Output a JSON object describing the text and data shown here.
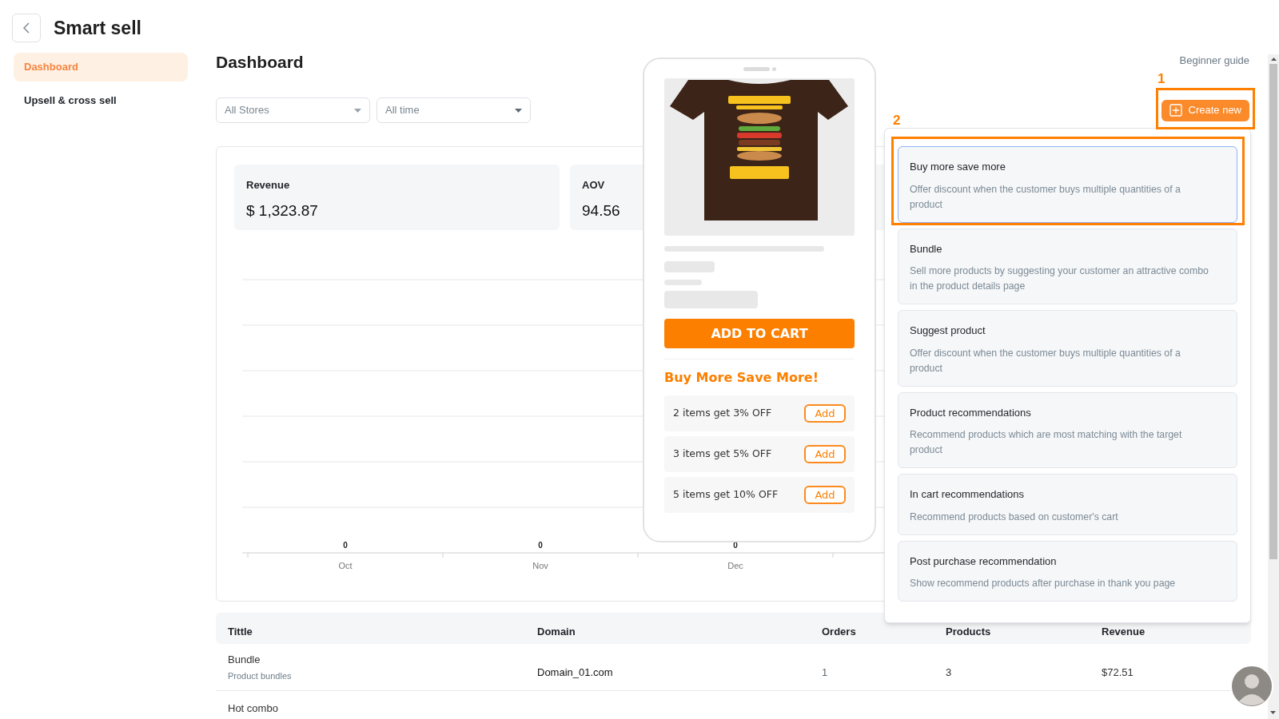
{
  "app": {
    "title": "Smart sell"
  },
  "sidebar": {
    "items": [
      {
        "label": "Dashboard",
        "selected": true
      },
      {
        "label": "Upsell & cross sell",
        "selected": false
      }
    ]
  },
  "page": {
    "title": "Dashboard",
    "guide_link": "Beginner guide",
    "create_button": "Create new"
  },
  "filters": [
    "All Stores",
    "All time"
  ],
  "stats": [
    {
      "label": "Revenue",
      "value": "$ 1,323.87"
    },
    {
      "label": "AOV",
      "value": "94.56"
    }
  ],
  "revenue_chart": {
    "columns": [
      {
        "month": "Oct",
        "value_label": "0"
      },
      {
        "month": "Nov",
        "value_label": "0"
      },
      {
        "month": "Dec",
        "value_label": "0"
      }
    ]
  },
  "table": {
    "columns": [
      "Tittle",
      "Domain",
      "Orders",
      "Products",
      "Revenue"
    ],
    "rows": [
      {
        "title": "Bundle",
        "subtitle": "Product bundles",
        "domain": "Domain_01.com",
        "orders": "1",
        "products": "3",
        "revenue": "$72.51"
      },
      {
        "title": "Hot combo"
      }
    ]
  },
  "preview": {
    "add_to_cart": "ADD TO CART",
    "offer_title": "Buy More Save More!",
    "tiers": [
      {
        "label": "2 items get 3% OFF",
        "button": "Add"
      },
      {
        "label": "3 items get 5% OFF",
        "button": "Add"
      },
      {
        "label": "5 items get 10% OFF",
        "button": "Add"
      }
    ]
  },
  "create_menu": {
    "options": [
      {
        "title": "Buy more save more",
        "description": "Offer discount when the customer buys multiple quantities of a product",
        "selected": true
      },
      {
        "title": "Bundle",
        "description": "Sell more products by suggesting your customer an attractive combo in the product details page",
        "selected": false
      },
      {
        "title": "Suggest product",
        "description": "Offer discount when the customer buys multiple quantities of a product",
        "selected": false
      },
      {
        "title": "Product recommendations",
        "description": "Recommend products which are most matching with the target product",
        "selected": false
      },
      {
        "title": "In cart recommendations",
        "description": "Recommend products based on customer's cart",
        "selected": false
      },
      {
        "title": "Post purchase recommendation",
        "description": "Show recommend products after purchase in thank you page",
        "selected": false
      }
    ]
  },
  "annotations": [
    {
      "label": "1"
    },
    {
      "label": "2"
    }
  ]
}
